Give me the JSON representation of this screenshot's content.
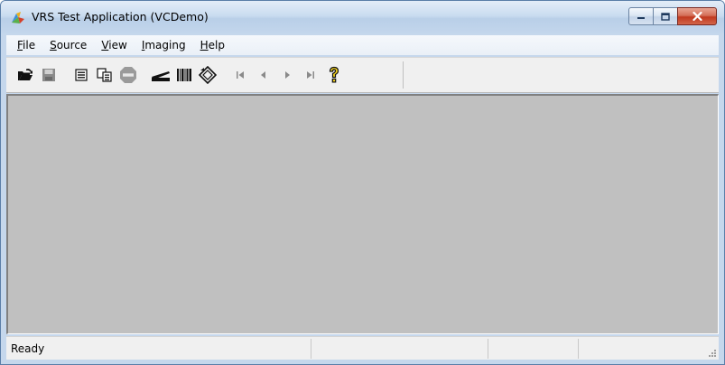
{
  "window": {
    "title": "VRS Test Application (VCDemo)",
    "icon": "vrs-app-icon",
    "caption_buttons": [
      "minimize-icon",
      "maximize-icon",
      "close-icon"
    ]
  },
  "menu": {
    "items": [
      {
        "mnemonic": "F",
        "rest": "ile"
      },
      {
        "mnemonic": "S",
        "rest": "ource"
      },
      {
        "mnemonic": "V",
        "rest": "iew"
      },
      {
        "mnemonic": "I",
        "rest": "maging"
      },
      {
        "mnemonic": "H",
        "rest": "elp"
      }
    ]
  },
  "toolbar": {
    "icons": [
      "open-folder-icon",
      "save-icon",
      "properties-icon",
      "copy-icon",
      "stop-icon",
      "scanner-icon",
      "barcode-icon",
      "rotate-icon",
      "first-page-icon",
      "previous-page-icon",
      "next-page-icon",
      "last-page-icon",
      "help-icon"
    ]
  },
  "status": {
    "text": "Ready"
  },
  "colors": {
    "client_background": "#c0c0c0",
    "close_button": "#c0391f",
    "frame": "#c5d7ec"
  }
}
